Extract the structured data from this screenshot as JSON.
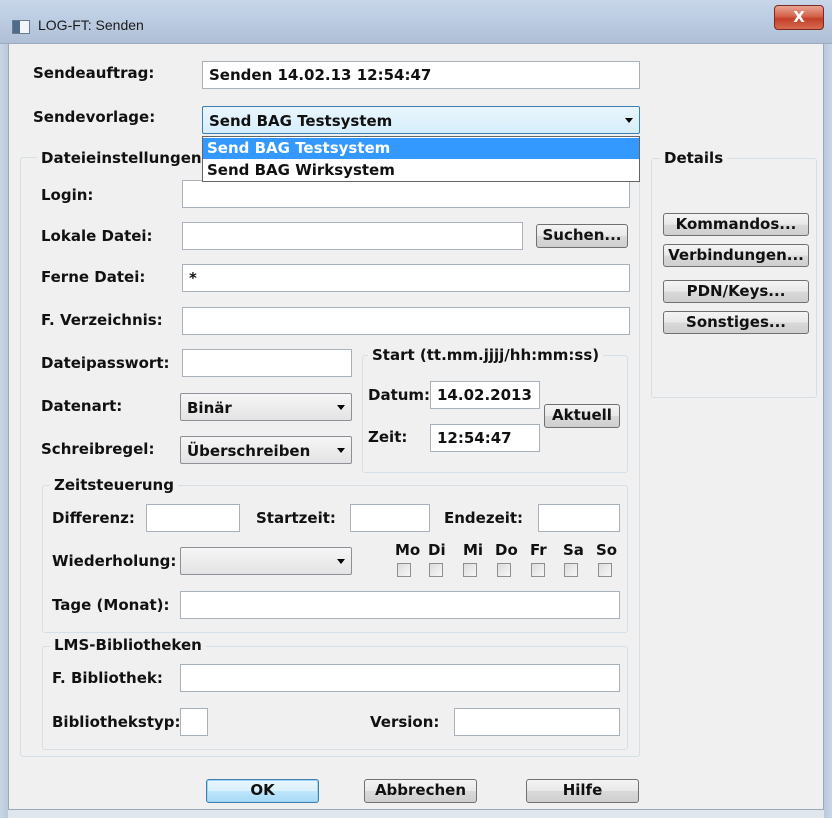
{
  "window": {
    "title": "LOG-FT: Senden",
    "close_label": "X"
  },
  "sendeauftrag": {
    "label": "Sendeauftrag:",
    "value": "Senden 14.02.13 12:54:47"
  },
  "sendevorlage": {
    "label": "Sendevorlage:",
    "value": "Send BAG Testsystem",
    "options": [
      "Send BAG Testsystem",
      "Send BAG Wirksystem"
    ],
    "selected_index": 0
  },
  "dateieinstellungen": {
    "title": "Dateieinstellungen",
    "login_label": "Login:",
    "login_value": "",
    "lokale_datei_label": "Lokale Datei:",
    "lokale_datei_value": "",
    "suchen_label": "Suchen...",
    "ferne_datei_label": "Ferne Datei:",
    "ferne_datei_value": "*",
    "f_verzeichnis_label": "F. Verzeichnis:",
    "f_verzeichnis_value": "",
    "dateipasswort_label": "Dateipasswort:",
    "dateipasswort_value": "",
    "datenart_label": "Datenart:",
    "datenart_value": "Binär",
    "schreibregel_label": "Schreibregel:",
    "schreibregel_value": "Überschreiben"
  },
  "start": {
    "title": "Start (tt.mm.jjjj/hh:mm:ss)",
    "datum_label": "Datum:",
    "datum_value": "14.02.2013",
    "zeit_label": "Zeit:",
    "zeit_value": "12:54:47",
    "aktuell_label": "Aktuell"
  },
  "zeitsteuerung": {
    "title": "Zeitsteuerung",
    "differenz_label": "Differenz:",
    "startzeit_label": "Startzeit:",
    "endezeit_label": "Endezeit:",
    "wiederholung_label": "Wiederholung:",
    "wiederholung_value": "",
    "days": [
      "Mo",
      "Di",
      "Mi",
      "Do",
      "Fr",
      "Sa",
      "So"
    ],
    "tage_label": "Tage (Monat):",
    "tage_value": ""
  },
  "lms": {
    "title": "LMS-Bibliotheken",
    "f_bibliothek_label": "F. Bibliothek:",
    "f_bibliothek_value": "",
    "bibliothekstyp_label": "Bibliothekstyp:",
    "version_label": "Version:"
  },
  "details": {
    "title": "Details",
    "kommandos_label": "Kommandos...",
    "verbindungen_label": "Verbindungen...",
    "pdn_keys_label": "PDN/Keys...",
    "sonstiges_label": "Sonstiges..."
  },
  "footer": {
    "ok_label": "OK",
    "abbrechen_label": "Abbrechen",
    "hilfe_label": "Hilfe"
  }
}
